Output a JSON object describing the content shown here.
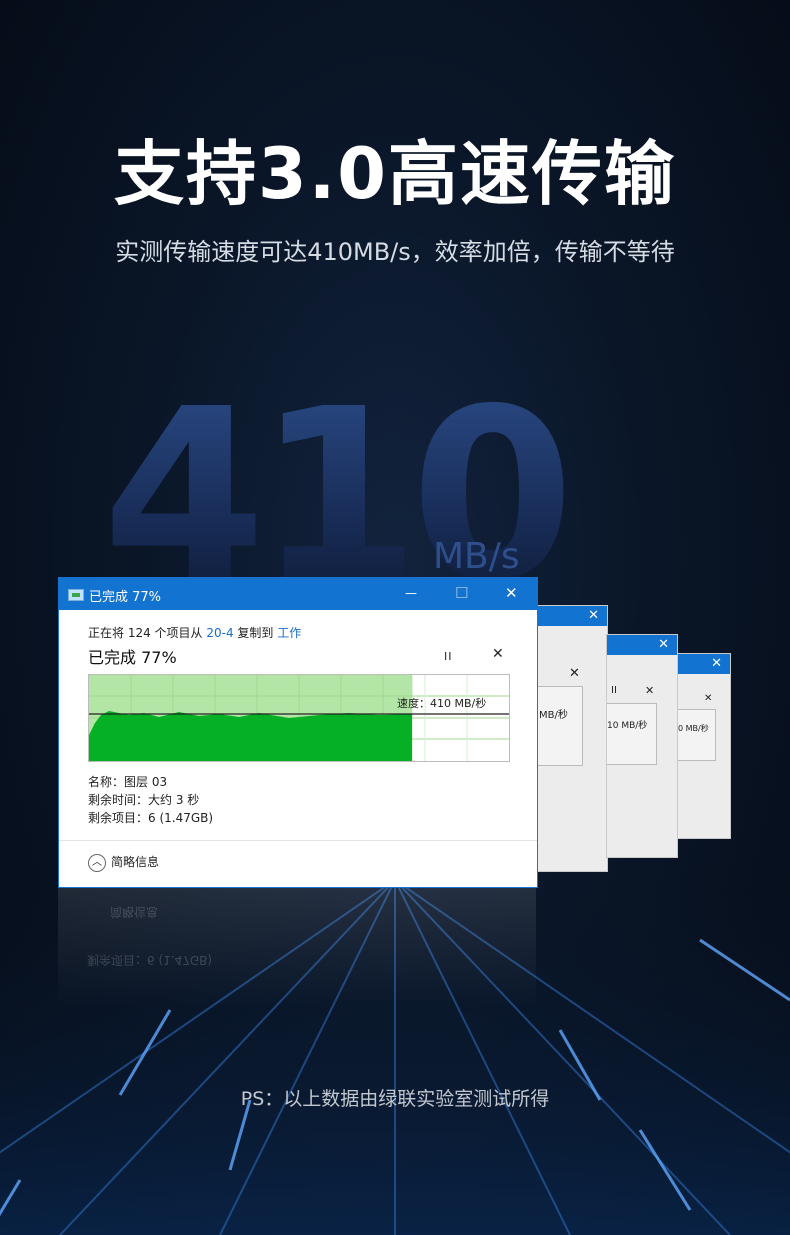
{
  "headline": "支持3.0高速传输",
  "subline": "实测传输速度可达410MB/s，效率加倍，传输不等待",
  "big_number": "410",
  "big_unit": "MB/s",
  "dialog": {
    "title": "已完成 77%",
    "title_controls": {
      "minimize": "—",
      "maximize": "☐",
      "close": "✕"
    },
    "copy_prefix": "正在将 124 个项目从 ",
    "source": "20-4",
    "copy_middle": " 复制到 ",
    "destination": "工作",
    "progress_text": "已完成 77%",
    "progress_percent": 77,
    "pause_label": "II",
    "cancel_label": "✕",
    "speed_label": "速度：410 MB/秒",
    "name_line": "名称：图层 03",
    "time_line": "剩余时间：大约 3 秒",
    "items_line": "剩余项目：6 (1.47GB)",
    "collapse_label": "简略信息",
    "collapse_icon": "chevron-up-icon"
  },
  "background_windows": [
    {
      "speed_label": "MB/秒",
      "close": "✕",
      "pause": "II"
    },
    {
      "speed_label": "10 MB/秒",
      "close": "✕",
      "pause": "II"
    },
    {
      "speed_label": "0 MB/秒",
      "close": "✕",
      "pause": "II"
    }
  ],
  "footnote": "PS：以上数据由绿联实验室测试所得",
  "colors": {
    "accent": "#1373d1",
    "progress_fill": "#06b025",
    "progress_light": "#b2e5a6",
    "background": "#0a1628"
  }
}
